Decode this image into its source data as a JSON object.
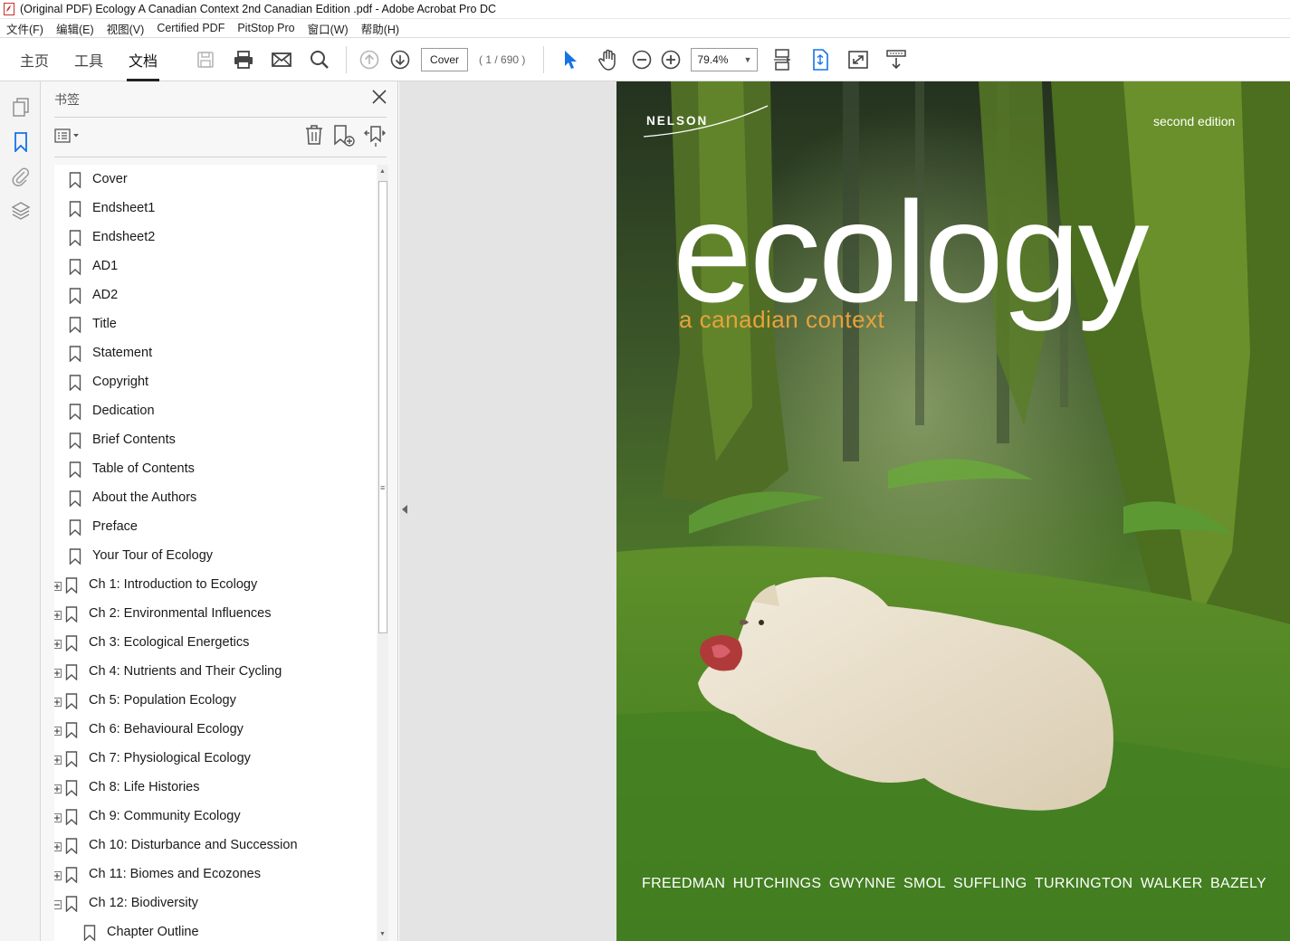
{
  "window": {
    "title": "(Original PDF) Ecology A Canadian Context 2nd Canadian Edition .pdf - Adobe Acrobat Pro DC"
  },
  "menu": [
    "文件(F)",
    "编辑(E)",
    "视图(V)",
    "Certified PDF",
    "PitStop Pro",
    "窗口(W)",
    "帮助(H)"
  ],
  "tabs": [
    {
      "label": "主页",
      "active": false
    },
    {
      "label": "工具",
      "active": false
    },
    {
      "label": "文档",
      "active": true
    }
  ],
  "toolbar": {
    "page_field": "Cover",
    "page_count": "( 1 / 690 )",
    "zoom": "79.4%"
  },
  "panel": {
    "title": "书签"
  },
  "bookmarks": [
    {
      "label": "Cover",
      "expandable": false
    },
    {
      "label": "Endsheet1",
      "expandable": false
    },
    {
      "label": "Endsheet2",
      "expandable": false
    },
    {
      "label": "AD1",
      "expandable": false
    },
    {
      "label": "AD2",
      "expandable": false
    },
    {
      "label": "Title",
      "expandable": false
    },
    {
      "label": "Statement",
      "expandable": false
    },
    {
      "label": "Copyright",
      "expandable": false
    },
    {
      "label": "Dedication",
      "expandable": false
    },
    {
      "label": "Brief Contents",
      "expandable": false
    },
    {
      "label": "Table of Contents",
      "expandable": false
    },
    {
      "label": "About the Authors",
      "expandable": false
    },
    {
      "label": "Preface",
      "expandable": false
    },
    {
      "label": "Your Tour of Ecology",
      "expandable": false
    },
    {
      "label": "Ch 1: Introduction to Ecology",
      "expandable": true
    },
    {
      "label": "Ch 2: Environmental Influences",
      "expandable": true
    },
    {
      "label": "Ch 3: Ecological Energetics",
      "expandable": true
    },
    {
      "label": "Ch 4: Nutrients and Their Cycling",
      "expandable": true
    },
    {
      "label": "Ch 5: Population Ecology",
      "expandable": true
    },
    {
      "label": "Ch 6: Behavioural Ecology",
      "expandable": true
    },
    {
      "label": "Ch 7: Physiological Ecology",
      "expandable": true
    },
    {
      "label": "Ch 8: Life Histories",
      "expandable": true
    },
    {
      "label": "Ch 9: Community Ecology",
      "expandable": true
    },
    {
      "label": "Ch 10: Disturbance and Succession",
      "expandable": true
    },
    {
      "label": "Ch 11: Biomes and Ecozones",
      "expandable": true
    },
    {
      "label": "Ch 12: Biodiversity",
      "expandable": true,
      "expanded": true
    },
    {
      "label": "Chapter Outline",
      "expandable": false,
      "child": true
    }
  ],
  "cover": {
    "publisher": "NELSON",
    "edition": "second edition",
    "title": "ecology",
    "subtitle": "a canadian context",
    "authors": [
      "FREEDMAN",
      "HUTCHINGS",
      "GWYNNE",
      "SMOL",
      "SUFFLING",
      "TURKINGTON",
      "WALKER",
      "BAZELY"
    ]
  },
  "colors": {
    "accent_blue": "#1473e6",
    "subtitle_orange": "#e8a23a",
    "forest_green": "#3f6b2a"
  }
}
